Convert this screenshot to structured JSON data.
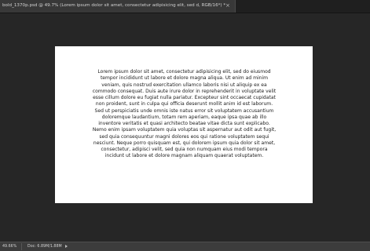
{
  "document_tab": {
    "title": "bold_1370p.psd @ 49.7% (Lorem ipsum dolor sit amet, consectetur adipisicing elit, sed d, RGB/16*) *",
    "close_glyph": "×"
  },
  "canvas": {
    "paragraph": "Lorem ipsum dolor sit amet, consectetur adipisicing elit, sed do eiusmod tempor incididunt ut labore et dolore magna aliqua. Ut enim ad minim veniam, quis nostrud exercitation ullamco laboris nisi ut aliquip ex ea commodo consequat. Duis aute irure dolor in reprehenderit in voluptate velit esse cillum dolore eu fugiat nulla pariatur. Excepteur sint occaecat cupidatat non proident, sunt in culpa qui officia deserunt mollit anim id est laborum. Sed ut perspiciatis unde omnis iste natus error sit voluptatem accusantium doloremque laudantium, totam rem aperiam, eaque ipsa quae ab illo inventore veritatis et quasi architecto beatae vitae dicta sunt explicabo. Nemo enim ipsam voluptatem quia voluptas sit aspernatur aut odit aut fugit, sed quia consequuntur magni dolores eos qui ratione voluptatem sequi nesciunt. Neque porro quisquam est, qui dolorem ipsum quia dolor sit amet, consectetur, adipisci velit, sed quia non numquam eius modi tempora incidunt ut labore et dolore magnam aliquam quaerat voluptatem."
  },
  "status_bar": {
    "zoom": "49.66%",
    "doc_size": "Doc: 6.89M/1.88M"
  },
  "colors": {
    "workspace": "#262626",
    "canvas": "#ffffff",
    "text": "#1a1a1a",
    "status_bar": "#3c3c3c",
    "tab": "#383838"
  },
  "icons": {
    "tab_close": "close-icon",
    "status_menu": "right-arrow-icon"
  }
}
